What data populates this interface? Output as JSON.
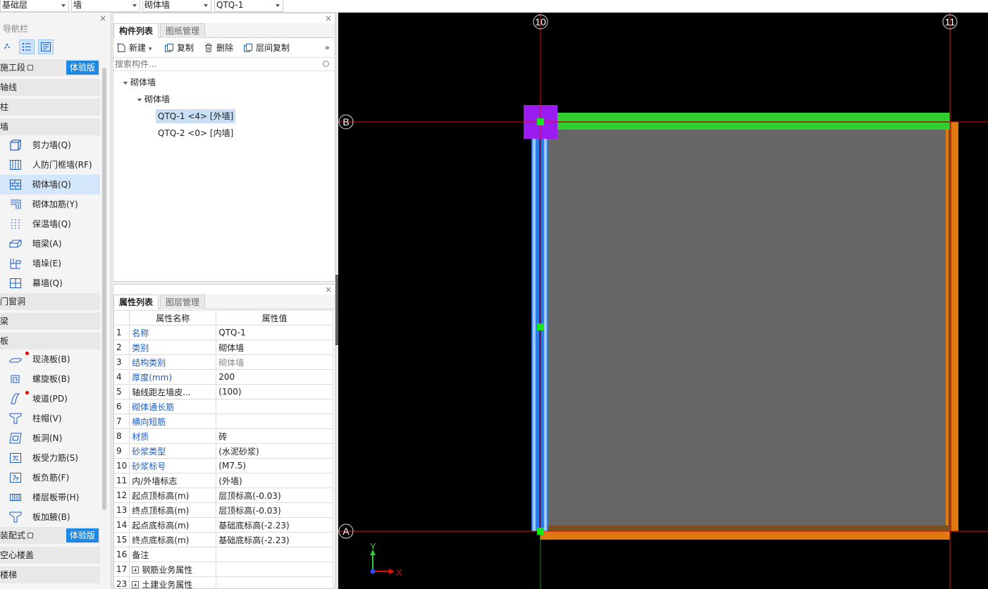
{
  "topbar": {
    "floor": "基础层",
    "category": "墙",
    "type": "砌体墙",
    "component": "QTQ-1"
  },
  "nav": {
    "title": "导航栏",
    "close": "×",
    "trial_label": "体验版",
    "groups_top": [
      {
        "label": "施工段",
        "lock": true,
        "badge": true
      },
      {
        "label": "轴线"
      },
      {
        "label": "柱"
      },
      {
        "label": "墙"
      }
    ],
    "wall_items": [
      {
        "label": "剪力墙(Q)",
        "icon": "shear-wall-icon"
      },
      {
        "label": "人防门框墙(RF)",
        "icon": "blast-door-frame-wall-icon"
      },
      {
        "label": "砌体墙(Q)",
        "icon": "masonry-wall-icon",
        "selected": true
      },
      {
        "label": "砌体加筋(Y)",
        "icon": "masonry-reinforcement-icon"
      },
      {
        "label": "保温墙(Q)",
        "icon": "insulation-wall-icon"
      },
      {
        "label": "暗梁(A)",
        "icon": "hidden-beam-icon"
      },
      {
        "label": "墙垛(E)",
        "icon": "wall-pier-icon"
      },
      {
        "label": "幕墙(Q)",
        "icon": "curtain-wall-icon"
      }
    ],
    "groups_mid": [
      {
        "label": "门窗洞"
      },
      {
        "label": "梁"
      },
      {
        "label": "板"
      }
    ],
    "slab_items": [
      {
        "label": "现浇板(B)",
        "icon": "cast-slab-icon",
        "dot": true
      },
      {
        "label": "螺旋板(B)",
        "icon": "spiral-slab-icon"
      },
      {
        "label": "坡道(PD)",
        "icon": "ramp-icon",
        "dot": true
      },
      {
        "label": "柱帽(V)",
        "icon": "column-cap-icon"
      },
      {
        "label": "板洞(N)",
        "icon": "slab-hole-icon"
      },
      {
        "label": "板受力筋(S)",
        "icon": "slab-stress-rebar-icon"
      },
      {
        "label": "板负筋(F)",
        "icon": "slab-negative-rebar-icon"
      },
      {
        "label": "楼层板带(H)",
        "icon": "floor-slab-strip-icon"
      },
      {
        "label": "板加腋(B)",
        "icon": "slab-haunch-icon"
      }
    ],
    "groups_bottom": [
      {
        "label": "装配式",
        "lock": true,
        "badge": true
      },
      {
        "label": "空心楼盖"
      },
      {
        "label": "楼梯"
      }
    ]
  },
  "component_panel": {
    "close": "×",
    "tabs": [
      "构件列表",
      "图纸管理"
    ],
    "toolbar": {
      "new": "新建",
      "copy": "复制",
      "delete": "删除",
      "floor_copy": "层间复制",
      "more": "»"
    },
    "search_placeholder": "搜索构件...",
    "tree": {
      "root": "砌体墙",
      "child": "砌体墙",
      "leaves": [
        "QTQ-1 <4> [外墙]",
        "QTQ-2 <0> [内墙]"
      ]
    }
  },
  "property_panel": {
    "close": "×",
    "tabs": [
      "属性列表",
      "图层管理"
    ],
    "headers": [
      "属性名称",
      "属性值"
    ],
    "rows": [
      {
        "n": "1",
        "name": "名称",
        "value": "QTQ-1",
        "blue": true
      },
      {
        "n": "2",
        "name": "类别",
        "value": "砌体墙",
        "blue": true
      },
      {
        "n": "3",
        "name": "结构类别",
        "value": "砌体墙",
        "blue": true,
        "gray": true
      },
      {
        "n": "4",
        "name": "厚度(mm)",
        "value": "200",
        "blue": true
      },
      {
        "n": "5",
        "name": "轴线距左墙皮...",
        "value": "(100)"
      },
      {
        "n": "6",
        "name": "砌体通长筋",
        "value": "",
        "blue": true
      },
      {
        "n": "7",
        "name": "横向短筋",
        "value": "",
        "blue": true
      },
      {
        "n": "8",
        "name": "材质",
        "value": "砖",
        "blue": true
      },
      {
        "n": "9",
        "name": "砂浆类型",
        "value": "(水泥砂浆)",
        "blue": true
      },
      {
        "n": "10",
        "name": "砂浆标号",
        "value": "(M7.5)",
        "blue": true
      },
      {
        "n": "11",
        "name": "内/外墙标志",
        "value": "(外墙)"
      },
      {
        "n": "12",
        "name": "起点顶标高(m)",
        "value": "层顶标高(-0.03)"
      },
      {
        "n": "13",
        "name": "终点顶标高(m)",
        "value": "层顶标高(-0.03)"
      },
      {
        "n": "14",
        "name": "起点底标高(m)",
        "value": "基础底标高(-2.23)"
      },
      {
        "n": "15",
        "name": "终点底标高(m)",
        "value": "基础底标高(-2.23)"
      },
      {
        "n": "16",
        "name": "备注",
        "value": ""
      },
      {
        "n": "17",
        "name": "钢筋业务属性",
        "value": "",
        "expand": true
      },
      {
        "n": "23",
        "name": "土建业务属性",
        "value": "",
        "expand": true
      }
    ]
  },
  "canvas": {
    "axis_10": "10",
    "axis_11": "11",
    "axis_B": "B",
    "axis_A": "A",
    "ucs_y": "Y",
    "ucs_x": "X",
    "colors": {
      "axis_line": "#e01010",
      "wall_green": "#2fd02f",
      "wall_blue": "#2a7de8",
      "wall_orange": "#e07a10",
      "slab_gray": "#666666",
      "selected_magenta": "#9b1cf0",
      "grip": "#19e619"
    }
  }
}
